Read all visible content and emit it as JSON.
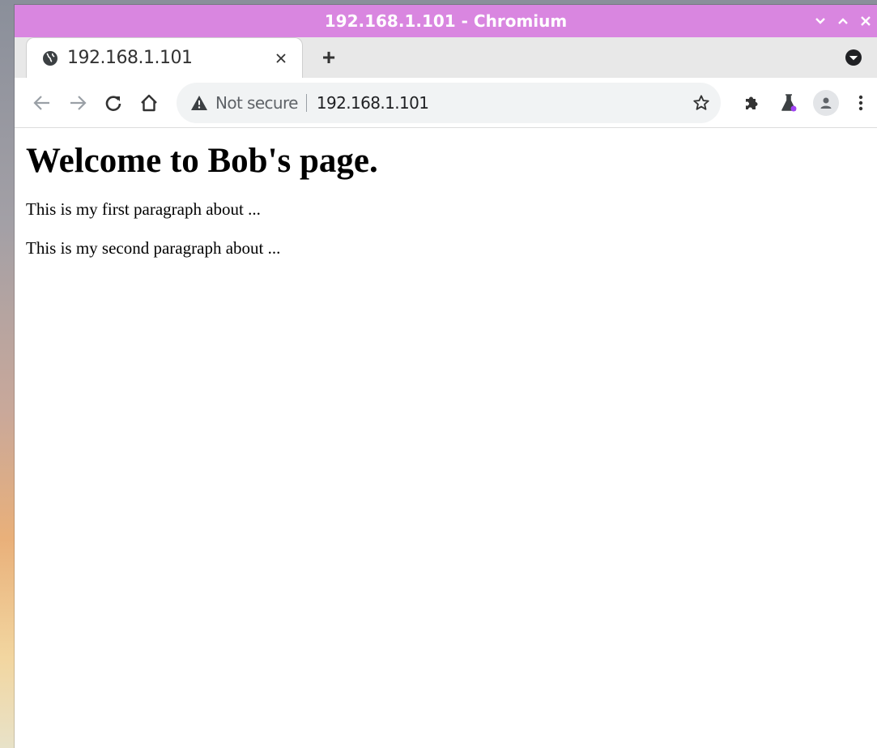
{
  "window": {
    "title": "192.168.1.101 - Chromium",
    "controls": {
      "minimize": "⌄",
      "maximize": "⌃",
      "close": "×"
    }
  },
  "tabs": [
    {
      "title": "192.168.1.101",
      "favicon": "globe-icon",
      "close_label": "×"
    }
  ],
  "new_tab_label": "+",
  "toolbar": {
    "security_label": "Not secure",
    "url": "192.168.1.101",
    "icons": [
      "back-arrow-icon",
      "forward-arrow-icon",
      "reload-icon",
      "home-icon",
      "warning-icon",
      "star-icon",
      "extensions-icon",
      "labs-icon",
      "profile-icon",
      "menu-icon"
    ]
  },
  "page": {
    "heading": "Welcome to Bob's page.",
    "paragraphs": [
      "This is my first paragraph about ...",
      "This is my second paragraph about ..."
    ]
  },
  "colors": {
    "titlebar": "#d986e0",
    "labs_dot": "#a142f4"
  }
}
